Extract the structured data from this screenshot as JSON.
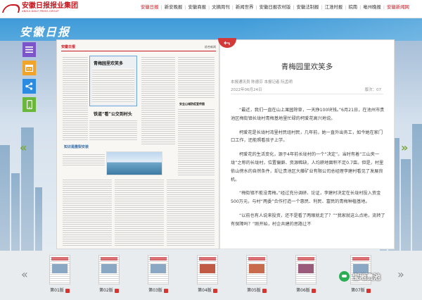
{
  "brand": {
    "name": "安徽日报报业集团",
    "en": "ANHUI DAILY PRESS GROUP"
  },
  "nav": {
    "items": [
      {
        "label": "安徽日报",
        "active": true
      },
      {
        "label": "新安晚报"
      },
      {
        "label": "安徽商报"
      },
      {
        "label": "文摘周刊"
      },
      {
        "label": "新闻世界"
      },
      {
        "label": "安徽日报农村版"
      },
      {
        "label": "安徽法制报"
      },
      {
        "label": "江淮时报"
      },
      {
        "label": "皖南"
      },
      {
        "label": "亳州晚报"
      },
      {
        "label": "安徽新闻网",
        "active": true
      }
    ]
  },
  "header": {
    "title": "安徽日报"
  },
  "tools": [
    "menu-icon",
    "calendar-icon",
    "share-icon",
    "mobile-icon"
  ],
  "newspaper": {
    "masthead": "安徽日报",
    "section": "综合新闻",
    "headlines": [
      "青梅园里欢笑多",
      "铁道“看”公交到村头",
      "知识是撒梨安装"
    ],
    "photo_caption": "安全山城防疫宣传图"
  },
  "article": {
    "title": "青梅园里欢笑多",
    "meta": "本报通讯员 陈德芬 本报记者 阮孟明",
    "date": "2022年06月24日",
    "views": "版次：07",
    "paragraphs": [
      "“最近，我们一直在山上果园除草，一天挣100块钱。”6月21日，在池州市贵池区梅街镇长垅村青梅基地里忙碌的柯爱花高兴地说。",
      "柯爱花是长垅村湾里村民组村民，几年前，她一直外出务工，如今她在家门口工作，还能照看孩子上学。",
      "柯爱花的生活变化，源于4年前长垅村的一个“决定”。当时有着“三山夹一垅”之称的长垅村，位置偏僻、资源稀缺，人均耕地面积不足0.7亩。但是，村里依山傍水的自然条件，却让贵池区大藤矿业有限公司总经理李建村看见了发展良机。",
      "“梅街镇不能没青梅。”经过充分调研、论证，李建村决定在长垅村投入资金500万元，与村“两委”合作打造一个惠民、利民、富民的青梅种植基地。",
      "“以前也有人说来投资，还不是看了两眼就走了？”“我家就这么点地，流转了有保障吗？”刚开始，村企共建的思路让不"
    ]
  },
  "thumbnails": [
    {
      "label": "第01版"
    },
    {
      "label": "第02版"
    },
    {
      "label": "第03版"
    },
    {
      "label": "第04版"
    },
    {
      "label": "第05版"
    },
    {
      "label": "第06版"
    },
    {
      "label": "第07版"
    }
  ],
  "watermark": {
    "text": "宝地贵池"
  }
}
